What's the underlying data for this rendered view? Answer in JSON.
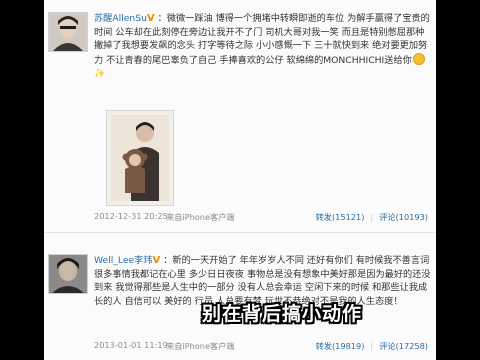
{
  "posts": [
    {
      "username": "苏醒AllenSu",
      "badge": "V",
      "text": "：微微一踩油 博得一个拥堵中转瞬即逝的车位 为解手赢得了宝贵的时间 公车却在此刻停在旁边让我开不了门 司机大哥对我一笑 而且是特别憋屈那种 撇掉了我想要发飙的念头 打字等待之际 小小感慨一下 三十就快到来 绝对要更加努力 不让青春的尾巴辜负了自己 手捧喜欢的公仔 软绵绵的MONCHHICHI送给你",
      "photo_alt": "photo-of-person-holding-plush-toy",
      "timestamp": "2012-12-31 20:25",
      "source": "来自iPhone客户端",
      "repost": "转发(15121)",
      "comment": "评论(10193)"
    },
    {
      "username": "Well_Lee李玮",
      "badge": "V",
      "text": "：新的一天开始了 年年岁岁人不同 还好有你们 有时候我不善言词 很多事情我都记在心里 多少日日夜夜 事物总是没有想象中美好那是因为最好的还没到来 我觉得那些是人生中的一部分 没有人总会幸运 空闲下来的时候 和那些让我成长的人 自信可以 美好的 行员 人总要有梦 玩世不恭绝对不是我的人生态度！",
      "timestamp": "2013-01-01 11:19",
      "source": "来自iPhone客户端",
      "repost": "转发(19819)",
      "comment": "评论(17258)"
    }
  ],
  "overlay_caption": "别在背后搞小动作",
  "colors": {
    "link": "#2b6ea9",
    "badge": "#f28a00",
    "meta": "#8d8d8d"
  }
}
